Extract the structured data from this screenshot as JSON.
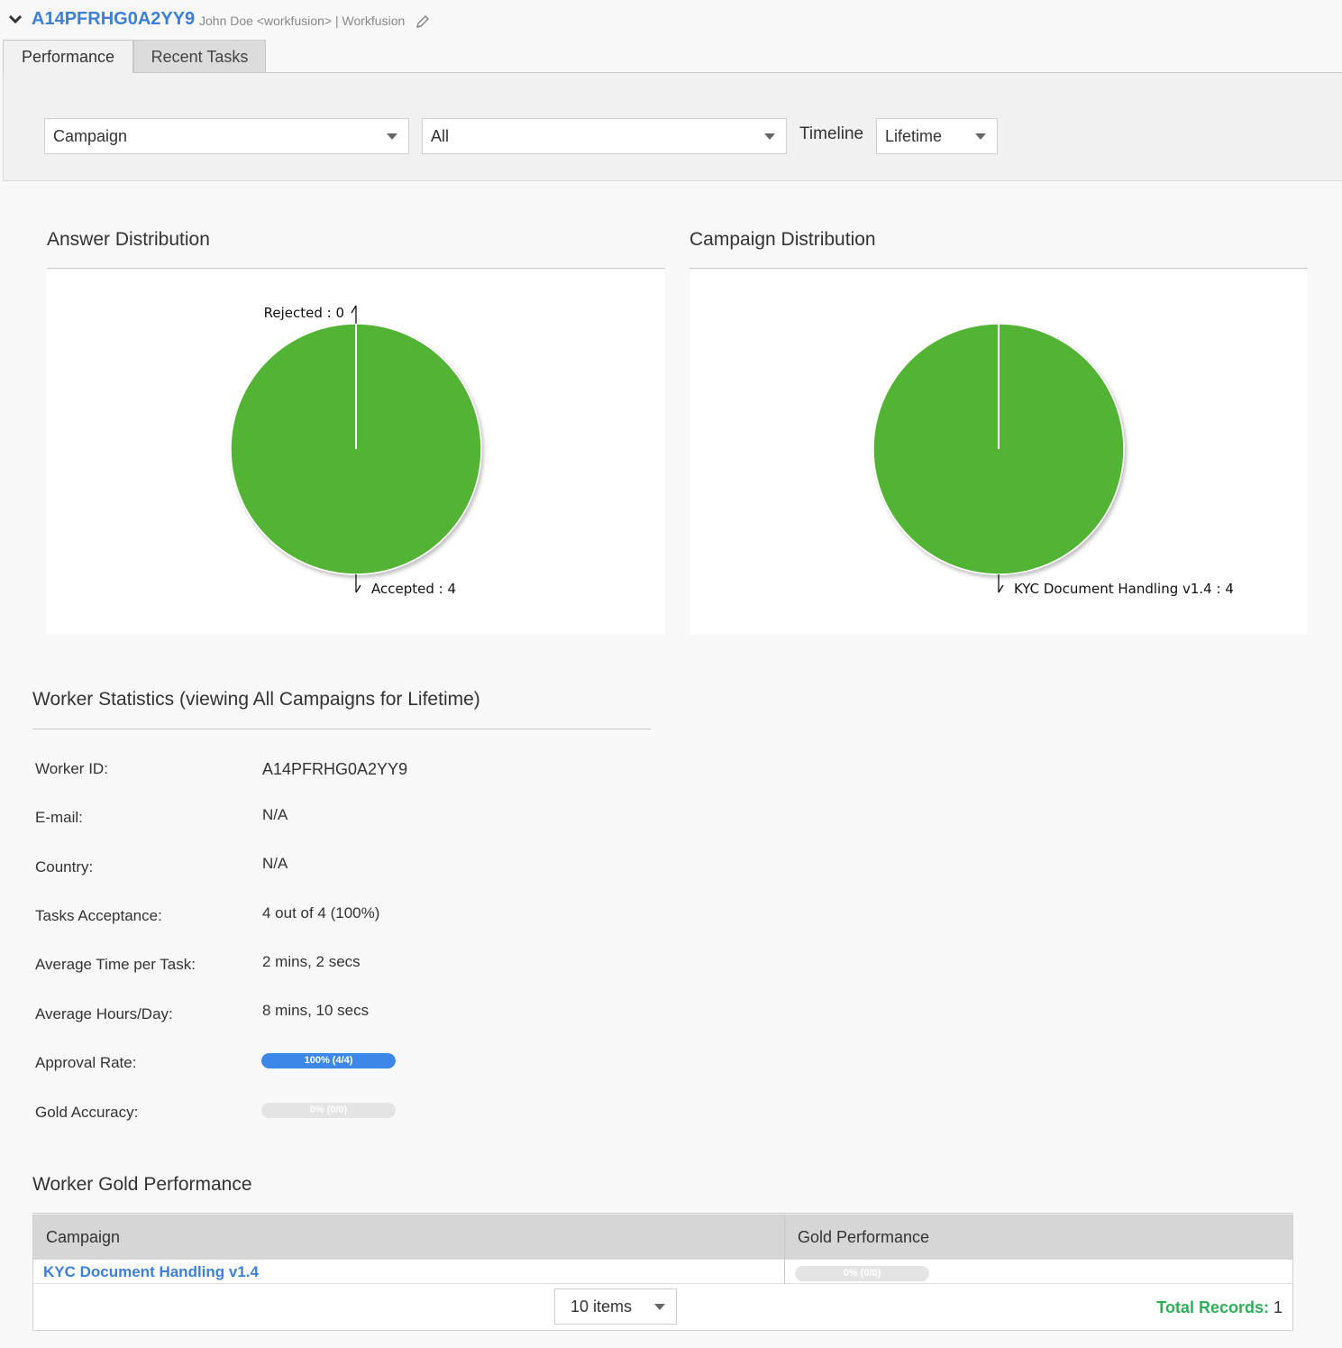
{
  "header": {
    "worker_id": "A14PFRHG0A2YY9",
    "user": "John Doe <workfusion> | Workfusion"
  },
  "tabs": [
    {
      "label": "Performance",
      "active": true
    },
    {
      "label": "Recent Tasks",
      "active": false
    }
  ],
  "filters": {
    "group_by": "Campaign",
    "campaign": "All",
    "timeline_label": "Timeline",
    "timeline": "Lifetime"
  },
  "answer_distribution": {
    "title": "Answer Distribution",
    "labels": [
      "Rejected : 0",
      "Accepted : 4"
    ]
  },
  "campaign_distribution": {
    "title": "Campaign Distribution",
    "labels": [
      "KYC Document Handling v1.4 : 4"
    ]
  },
  "chart_data": [
    {
      "type": "pie",
      "title": "Answer Distribution",
      "categories": [
        "Rejected",
        "Accepted"
      ],
      "values": [
        0,
        4
      ],
      "colors": [
        "#52b334",
        "#52b334"
      ]
    },
    {
      "type": "pie",
      "title": "Campaign Distribution",
      "categories": [
        "KYC Document Handling v1.4"
      ],
      "values": [
        4
      ],
      "colors": [
        "#52b334"
      ]
    }
  ],
  "stats": {
    "title": "Worker Statistics (viewing All Campaigns for Lifetime)",
    "rows": [
      {
        "label": "Worker ID:",
        "value": "A14PFRHG0A2YY9"
      },
      {
        "label": "E-mail:",
        "value": "N/A"
      },
      {
        "label": "Country:",
        "value": "N/A"
      },
      {
        "label": "Tasks Acceptance:",
        "value": "4 out of 4 (100%)"
      },
      {
        "label": "Average Time per Task:",
        "value": "2 mins, 2 secs"
      },
      {
        "label": "Average Hours/Day:",
        "value": "8 mins, 10 secs"
      }
    ],
    "approval": {
      "label": "Approval Rate:",
      "text": "100% (4/4)",
      "fraction": 1.0
    },
    "gold": {
      "label": "Gold Accuracy:",
      "text": "0% (0/0)",
      "fraction": 0.0
    }
  },
  "gold_performance": {
    "title": "Worker Gold Performance",
    "columns": [
      "Campaign",
      "Gold Performance"
    ],
    "rows": [
      {
        "campaign": "KYC Document Handling v1.4",
        "performance_text": "0% (0/0)",
        "fraction": 0.0
      }
    ],
    "page_size": "10 items",
    "total_label": "Total Records:",
    "total_value": "1"
  },
  "colors": {
    "accent": "#3d7ed6",
    "pie_green": "#52b334",
    "progress_blue": "#3d87e8",
    "total_green": "#2fae5a"
  }
}
